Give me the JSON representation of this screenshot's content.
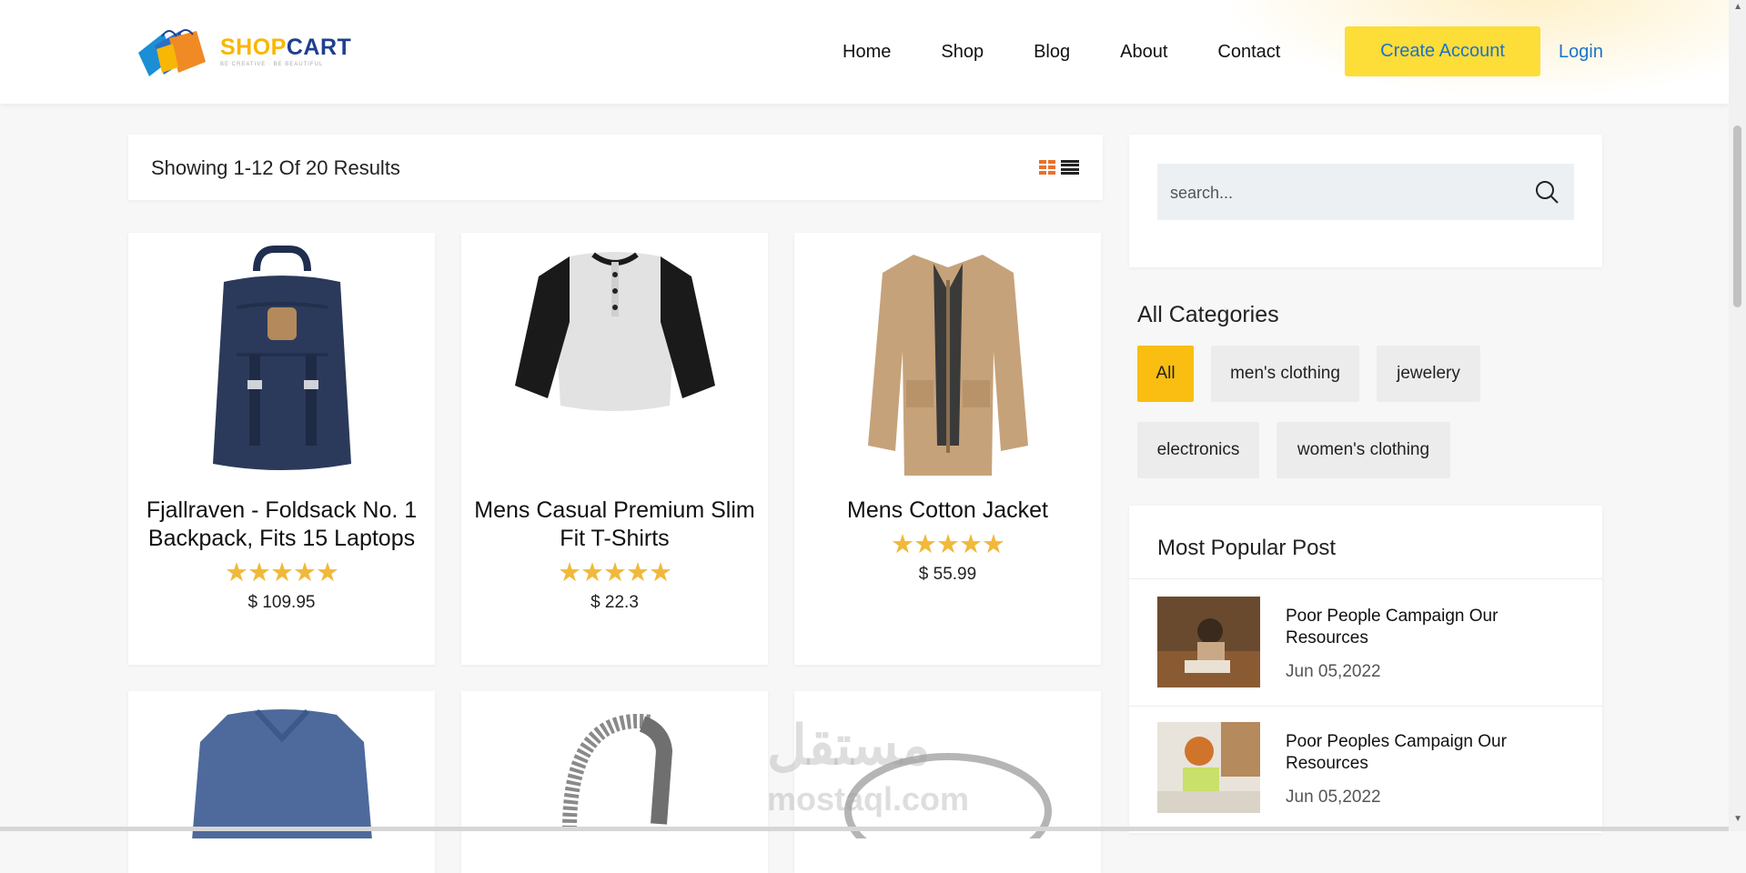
{
  "brand": {
    "shop": "SHOP",
    "cart": "CART",
    "tagline": "BE CREATIVE · BE BEAUTIFUL",
    "colors": {
      "yellow": "#f8b704",
      "navy": "#1f3f8f",
      "orange": "#e9712c"
    }
  },
  "nav": {
    "home": "Home",
    "shop": "Shop",
    "blog": "Blog",
    "about": "About",
    "contact": "Contact",
    "create_account": "Create Account",
    "login": "Login"
  },
  "results": {
    "text": "Showing 1-12 Of 20 Results"
  },
  "products": [
    {
      "title": "Fjallraven - Foldsack No. 1 Backpack, Fits 15 Laptops",
      "rating": 5,
      "stars": "★★★★★",
      "price": "$ 109.95",
      "image": "backpack"
    },
    {
      "title": "Mens Casual Premium Slim Fit T-Shirts",
      "rating": 5,
      "stars": "★★★★★",
      "price": "$ 22.3",
      "image": "raglan-tshirt"
    },
    {
      "title": "Mens Cotton Jacket",
      "rating": 5,
      "stars": "★★★★★",
      "price": "$ 55.99",
      "image": "jacket"
    },
    {
      "title": "",
      "image": "sweater"
    },
    {
      "title": "",
      "image": "dragon-bracelet"
    },
    {
      "title": "",
      "image": "silver-ring"
    }
  ],
  "search": {
    "placeholder": "search..."
  },
  "categories": {
    "title": "All Categories",
    "items": [
      "All",
      "men's clothing",
      "jewelery",
      "electronics",
      "women's clothing"
    ],
    "active": "All"
  },
  "popular": {
    "title": "Most Popular Post",
    "posts": [
      {
        "title": "Poor People Campaign Our Resources",
        "date": "Jun 05,2022"
      },
      {
        "title": "Poor Peoples Campaign Our Resources",
        "date": "Jun 05,2022"
      }
    ]
  },
  "watermark": {
    "arabic": "مستقل",
    "latin": "mostaql.com"
  }
}
